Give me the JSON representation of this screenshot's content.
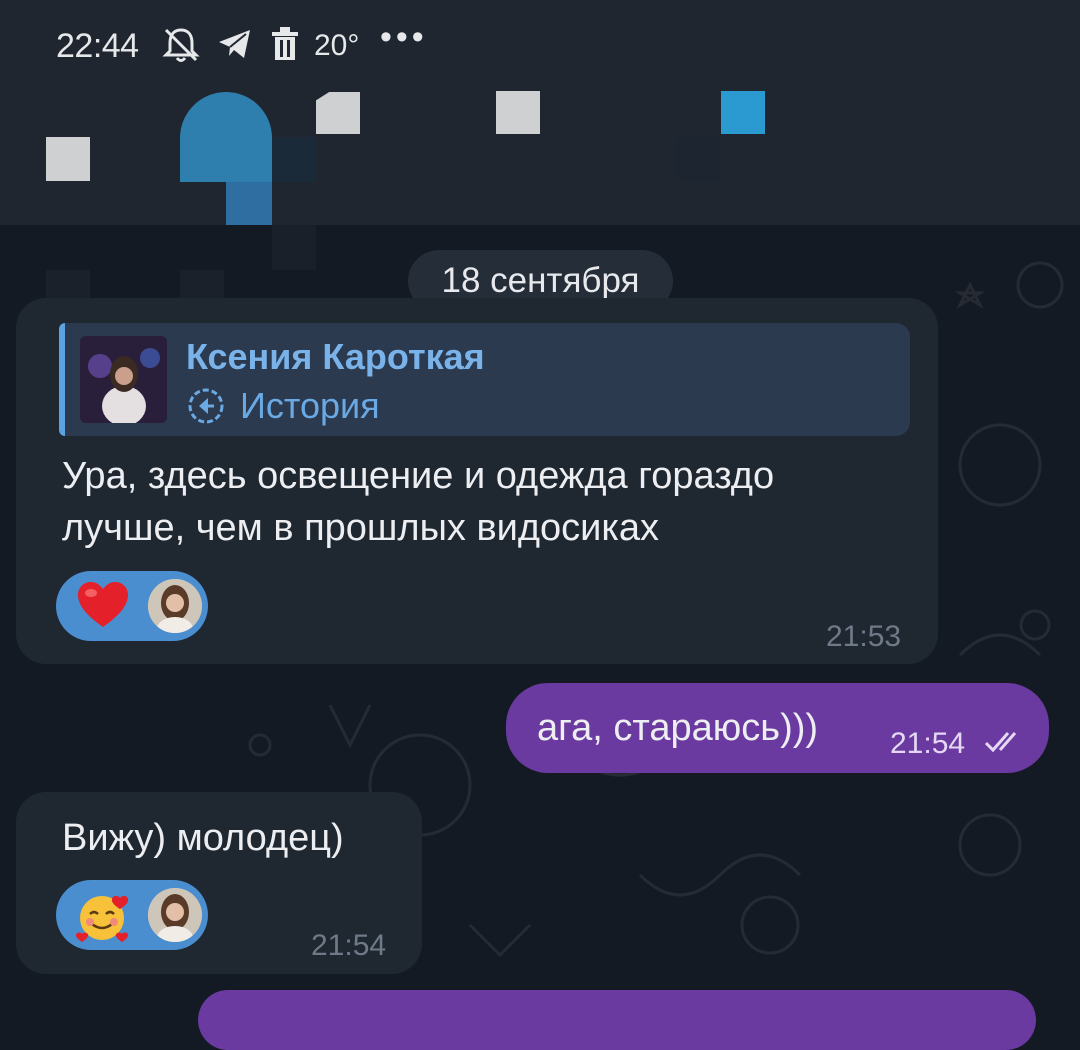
{
  "status_bar": {
    "time": "22:44",
    "temperature": "20°",
    "more": "•••",
    "icons": [
      "bell-muted-icon",
      "telegram-icon",
      "trash-icon"
    ]
  },
  "chat": {
    "date_divider": "18 сентября",
    "messages": [
      {
        "direction": "incoming",
        "reply": {
          "author": "Ксения Кароткая",
          "subtitle": "История"
        },
        "text_line1": "Ура, здесь освещение и одежда гораздо",
        "text_line2": "лучше, чем в прошлых видосиках",
        "time": "21:53",
        "reaction": {
          "emoji": "heart-icon"
        }
      },
      {
        "direction": "outgoing",
        "text": "ага, стараюсь)))",
        "time": "21:54",
        "status": "double-check-icon"
      },
      {
        "direction": "incoming",
        "text": "Вижу) молодец)",
        "time": "21:54",
        "reaction": {
          "emoji": "smiling-face-with-hearts-icon"
        }
      }
    ]
  },
  "colors": {
    "background": "#141a23",
    "incoming_bubble": "#1f2731",
    "outgoing_bubble": "#6a3aa0",
    "reaction_pill": "#4a8ed0",
    "reply_accent": "#5aa2e0"
  }
}
